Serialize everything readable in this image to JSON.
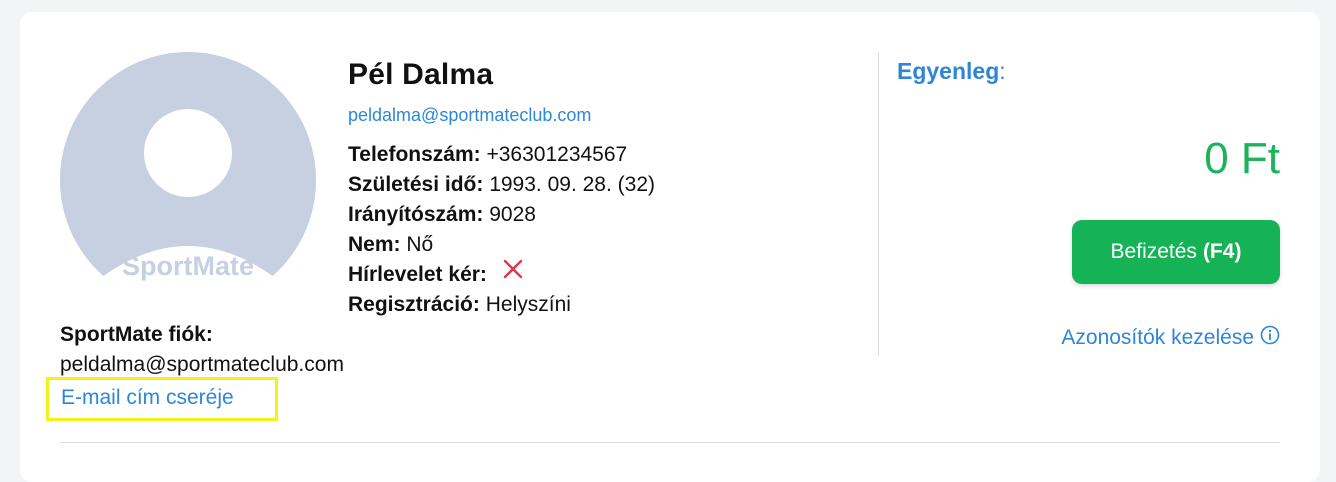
{
  "profile": {
    "name": "Pél Dalma",
    "email": "peldalma@sportmateclub.com",
    "avatar_logo_text": "SportMate",
    "details": [
      {
        "label": "Telefonszám:",
        "value": "+36301234567"
      },
      {
        "label": "Születési idő:",
        "value": "1993. 09. 28. (32)"
      },
      {
        "label": "Irányítószám:",
        "value": "9028"
      },
      {
        "label": "Nem:",
        "value": "Nő"
      },
      {
        "label": "Hírlevelet kér:",
        "value": ""
      },
      {
        "label": "Regisztráció:",
        "value": "Helyszíni"
      }
    ],
    "newsletter_icon": "x-icon"
  },
  "account": {
    "label": "SportMate fiók:",
    "email": "peldalma@sportmateclub.com",
    "change_email_link": "E-mail cím cseréje"
  },
  "balance": {
    "label": "Egyenleg",
    "colon": ":",
    "value": "0 Ft",
    "deposit_label": "Befizetés",
    "deposit_shortcut": "(F4)",
    "manage_ids_link": "Azonosítók kezelése",
    "info_icon": "info-icon"
  },
  "colors": {
    "accent_blue": "#2e86d8",
    "balance_green": "#1db35a",
    "button_green": "#15b356",
    "negative_red": "#e0374a",
    "highlight_yellow": "#f5f019",
    "avatar_gray": "#c7d0e0"
  }
}
